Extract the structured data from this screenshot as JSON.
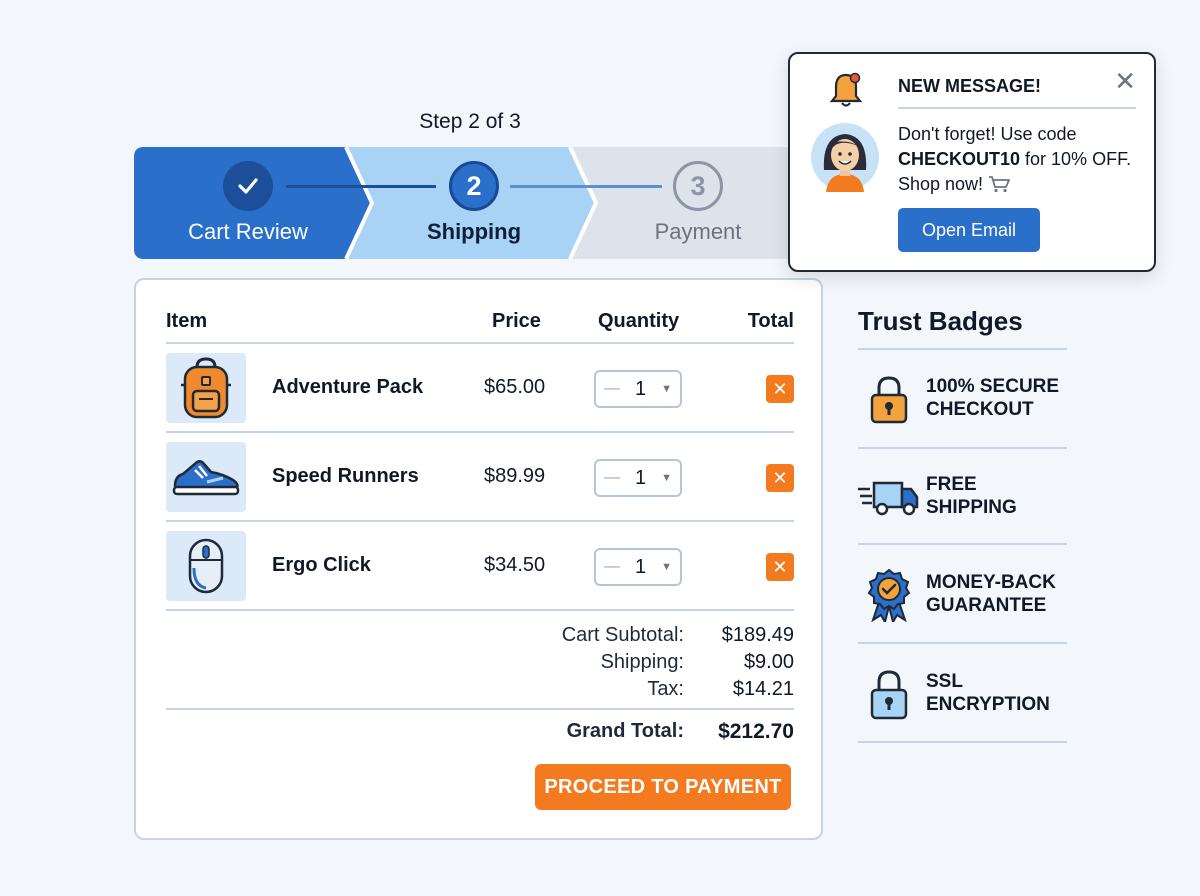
{
  "progress": {
    "step_text": "Step 2 of 3",
    "steps": [
      {
        "number": "",
        "label": "Cart Review",
        "state": "complete"
      },
      {
        "number": "2",
        "label": "Shipping",
        "state": "current"
      },
      {
        "number": "3",
        "label": "Payment",
        "state": "upcoming"
      }
    ]
  },
  "cart": {
    "headers": {
      "item": "Item",
      "price": "Price",
      "quantity": "Quantity",
      "total": "Total"
    },
    "items": [
      {
        "name": "Adventure Pack",
        "price": "$65.00",
        "quantity": "1",
        "icon": "backpack-icon"
      },
      {
        "name": "Speed Runners",
        "price": "$89.99",
        "quantity": "1",
        "icon": "sneaker-icon"
      },
      {
        "name": "Ergo Click",
        "price": "$34.50",
        "quantity": "1",
        "icon": "mouse-icon"
      }
    ],
    "summary": {
      "subtotal_label": "Cart Subtotal:",
      "subtotal": "$189.49",
      "shipping_label": "Shipping:",
      "shipping": "$9.00",
      "tax_label": "Tax:",
      "tax": "$14.21",
      "grand_label": "Grand Total:",
      "grand": "$212.70"
    },
    "proceed_label": "PROCEED TO PAYMENT"
  },
  "trust": {
    "title": "Trust Badges",
    "badges": [
      {
        "text": "100% SECURE\nCHECKOUT",
        "icon": "padlock-icon"
      },
      {
        "text": "FREE\nSHIPPING",
        "icon": "delivery-truck-icon"
      },
      {
        "text": "MONEY-BACK\nGUARANTEE",
        "icon": "award-ribbon-icon"
      },
      {
        "text": "SSL\nENCRYPTION",
        "icon": "ssl-lock-icon"
      }
    ]
  },
  "notification": {
    "title": "NEW MESSAGE!",
    "message_prefix": "Don't forget! Use code ",
    "code": "CHECKOUT10",
    "message_suffix": " for 10% OFF. Shop now!",
    "button_label": "Open Email"
  },
  "colors": {
    "primary_blue": "#2a6fca",
    "dark_blue": "#1d4e9a",
    "light_blue": "#a9d3f5",
    "accent_orange": "#f47a20",
    "border": "#c5d3e2"
  }
}
